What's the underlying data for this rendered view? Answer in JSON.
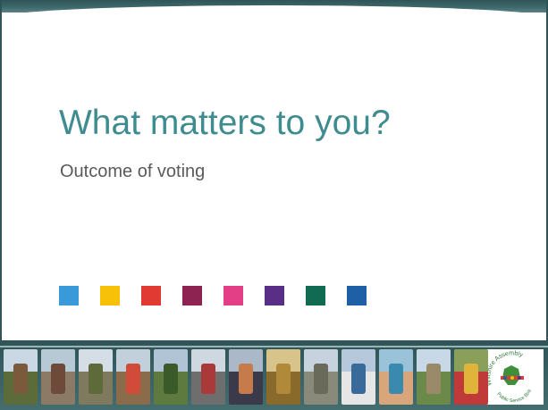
{
  "slide": {
    "title": "What matters to you?",
    "subtitle": "Outcome of voting"
  },
  "colors": {
    "title": "#3f8c90",
    "subtitle": "#5a5a5a",
    "band": "#2f5457"
  },
  "color_squares": [
    "#3a9ad9",
    "#f7c10a",
    "#e03a32",
    "#8c2350",
    "#e23f86",
    "#5a2d86",
    "#116b52",
    "#1f5fa6"
  ],
  "photo_strip": {
    "photos": [
      "village-street-photo",
      "street-view-photo",
      "church-tower-photo",
      "market-street-photo",
      "cyclists-photo",
      "traffic-road-photo",
      "dancers-photo",
      "autumn-park-photo",
      "church-photo",
      "bus-photo",
      "swimmers-photo",
      "countryside-photo",
      "vegetable-market-photo"
    ],
    "logo_icon": "wiltshire-assembly-logo",
    "logo_text": "Wiltshire Assembly Public Service Board"
  }
}
